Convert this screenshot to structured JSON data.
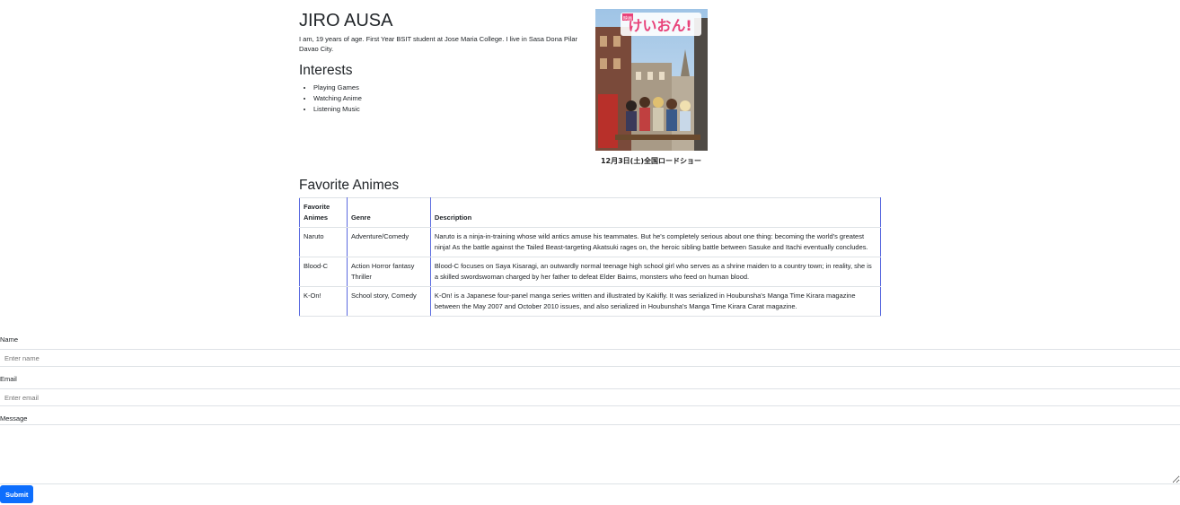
{
  "profile": {
    "name": "JIRO AUSA",
    "bio": "I am, 19 years of age. First Year BSIT student at Jose Maria College. I live in Sasa Dona Pilar Davao City.",
    "interests_title": "Interests",
    "interests": [
      "Playing Games",
      "Watching Anime",
      "Listening Music"
    ]
  },
  "poster": {
    "title_text": "けいおん!",
    "badge_text": "映画",
    "date_text": "12月3日(土)全国ロードショー"
  },
  "favorites": {
    "title": "Favorite Animes",
    "headers": [
      "Favorite Animes",
      "Genre",
      "Description"
    ],
    "rows": [
      {
        "anime": "Naruto",
        "genre": "Adventure/Comedy",
        "description": "Naruto is a ninja-in-training whose wild antics amuse his teammates. But he's completely serious about one thing: becoming the world's greatest ninja! As the battle against the Tailed Beast-targeting Akatsuki rages on, the heroic sibling battle between Sasuke and Itachi eventually concludes."
      },
      {
        "anime": "Blood-C",
        "genre": "Action Horror fantasy Thriller",
        "description": "Blood-C focuses on Saya Kisaragi, an outwardly normal teenage high school girl who serves as a shrine maiden to a country town; in reality, she is a skilled swordswoman charged by her father to defeat Elder Bairns, monsters who feed on human blood."
      },
      {
        "anime": "K-On!",
        "genre": "School story, Comedy",
        "description": "K-On! is a Japanese four-panel manga series written and illustrated by Kakifly. It was serialized in Houbunsha's Manga Time Kirara magazine between the May 2007 and October 2010 issues, and also serialized in Houbunsha's Manga Time Kirara Carat magazine."
      }
    ]
  },
  "form": {
    "name_label": "Name",
    "name_placeholder": "Enter name",
    "email_label": "Email",
    "email_placeholder": "Enter email",
    "message_label": "Message",
    "submit_label": "Submit"
  },
  "colors": {
    "primary": "#0d6efd",
    "table_accent": "#5b6be0"
  }
}
